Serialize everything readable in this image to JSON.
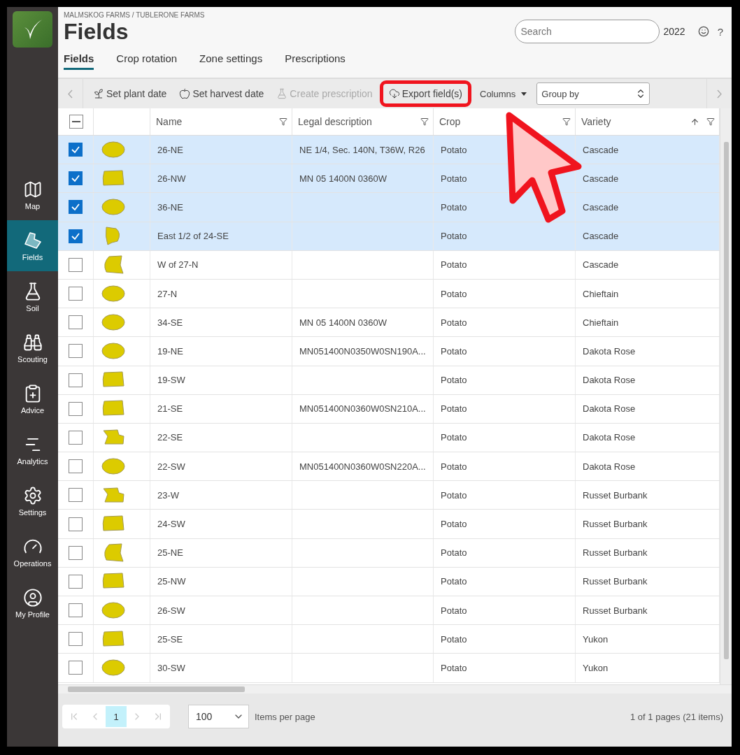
{
  "breadcrumb": "MALMSKOG FARMS / TUBLERONE FARMS",
  "title": "Fields",
  "search": {
    "placeholder": "Search"
  },
  "year": "2022",
  "help": "?",
  "sidebar": [
    {
      "label": "Map",
      "selected": false
    },
    {
      "label": "Fields",
      "selected": true
    },
    {
      "label": "Soil",
      "selected": false
    },
    {
      "label": "Scouting",
      "selected": false
    },
    {
      "label": "Advice",
      "selected": false
    },
    {
      "label": "Analytics",
      "selected": false
    },
    {
      "label": "Settings",
      "selected": false
    },
    {
      "label": "Operations",
      "selected": false
    },
    {
      "label": "My Profile",
      "selected": false
    }
  ],
  "tabs": [
    {
      "label": "Fields",
      "selected": true
    },
    {
      "label": "Crop rotation",
      "selected": false
    },
    {
      "label": "Zone settings",
      "selected": false
    },
    {
      "label": "Prescriptions",
      "selected": false
    }
  ],
  "toolbar": [
    {
      "label": "Set plant date",
      "disabled": false,
      "highlighted": false
    },
    {
      "label": "Set harvest date",
      "disabled": false,
      "highlighted": false
    },
    {
      "label": "Create prescription",
      "disabled": true,
      "highlighted": false
    },
    {
      "label": "Export field(s)",
      "disabled": false,
      "highlighted": true
    }
  ],
  "columns_button": "Columns",
  "group_by": "Group by",
  "table": {
    "indeterminate": true,
    "columns": [
      {
        "label": "Name",
        "sorted": false
      },
      {
        "label": "Legal description",
        "sorted": false
      },
      {
        "label": "Crop",
        "sorted": false
      },
      {
        "label": "Variety",
        "sorted": true
      }
    ],
    "rows": [
      {
        "checked": true,
        "name": "26-NE",
        "legal": "NE 1/4, Sec. 140N, T36W, R26",
        "crop": "Potato",
        "variety": "Cascade"
      },
      {
        "checked": true,
        "name": "26-NW",
        "legal": "MN 05 1400N 0360W",
        "crop": "Potato",
        "variety": "Cascade"
      },
      {
        "checked": true,
        "name": "36-NE",
        "crop": "Potato",
        "variety": "Cascade"
      },
      {
        "checked": true,
        "name": "East 1/2 of 24-SE",
        "crop": "Potato",
        "variety": "Cascade"
      },
      {
        "checked": false,
        "name": "W of 27-N",
        "crop": "Potato",
        "variety": "Cascade"
      },
      {
        "checked": false,
        "name": "27-N",
        "crop": "Potato",
        "variety": "Chieftain"
      },
      {
        "checked": false,
        "name": "34-SE",
        "legal": "MN 05 1400N 0360W",
        "crop": "Potato",
        "variety": "Chieftain"
      },
      {
        "checked": false,
        "name": "19-NE",
        "legal": "MN051400N0350W0SN190A...",
        "crop": "Potato",
        "variety": "Dakota Rose"
      },
      {
        "checked": false,
        "name": "19-SW",
        "crop": "Potato",
        "variety": "Dakota Rose"
      },
      {
        "checked": false,
        "name": "21-SE",
        "legal": "MN051400N0360W0SN210A...",
        "crop": "Potato",
        "variety": "Dakota Rose"
      },
      {
        "checked": false,
        "name": "22-SE",
        "crop": "Potato",
        "variety": "Dakota Rose"
      },
      {
        "checked": false,
        "name": "22-SW",
        "legal": "MN051400N0360W0SN220A...",
        "crop": "Potato",
        "variety": "Dakota Rose"
      },
      {
        "checked": false,
        "name": "23-W",
        "crop": "Potato",
        "variety": "Russet Burbank"
      },
      {
        "checked": false,
        "name": "24-SW",
        "crop": "Potato",
        "variety": "Russet Burbank"
      },
      {
        "checked": false,
        "name": "25-NE",
        "crop": "Potato",
        "variety": "Russet Burbank"
      },
      {
        "checked": false,
        "name": "25-NW",
        "crop": "Potato",
        "variety": "Russet Burbank"
      },
      {
        "checked": false,
        "name": "26-SW",
        "crop": "Potato",
        "variety": "Russet Burbank"
      },
      {
        "checked": false,
        "name": "25-SE",
        "crop": "Potato",
        "variety": "Yukon"
      },
      {
        "checked": false,
        "name": "30-SW",
        "crop": "Potato",
        "variety": "Yukon"
      }
    ]
  },
  "pager": {
    "pages": [
      {
        "label": "1",
        "selected": true
      }
    ],
    "page_size": "100",
    "page_size_label": "Items per page",
    "summary": "1 of 1 pages (21 items)"
  }
}
